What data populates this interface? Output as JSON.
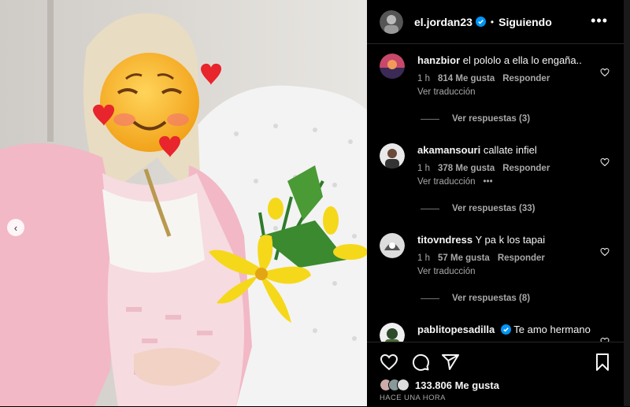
{
  "header": {
    "username": "el.jordan23",
    "separator": "•",
    "follow_label": "Siguiendo",
    "more_label": "•••"
  },
  "photo": {
    "prev_label": "‹"
  },
  "comments": [
    {
      "user": "hanzbior",
      "text": "el pololo a ella lo engaña..",
      "time": "1 h",
      "likes": "814 Me gusta",
      "reply": "Responder",
      "translate": "Ver traducción",
      "replies": "Ver respuestas (3)"
    },
    {
      "user": "akamansouri",
      "text": "callate infiel",
      "time": "1 h",
      "likes": "378 Me gusta",
      "reply": "Responder",
      "translate": "Ver traducción",
      "extra": "•••",
      "replies": "Ver respuestas (33)"
    },
    {
      "user": "titovndress",
      "text": "Y pa k los tapai",
      "time": "1 h",
      "likes": "57 Me gusta",
      "reply": "Responder",
      "translate": "Ver traducción",
      "replies": "Ver respuestas (8)"
    },
    {
      "user": "pablitopesadilla",
      "text": "Te amo hermano"
    }
  ],
  "actions": {
    "likes": "133.806 Me gusta",
    "time": "HACE UNA HORA"
  },
  "colors": {
    "verified": "#0095f6",
    "background": "#000000",
    "secondary_text": "#a8a8a8"
  },
  "icons": [
    "heart-icon",
    "comment-icon",
    "share-icon",
    "save-icon",
    "more-icon",
    "verified-badge-icon"
  ]
}
